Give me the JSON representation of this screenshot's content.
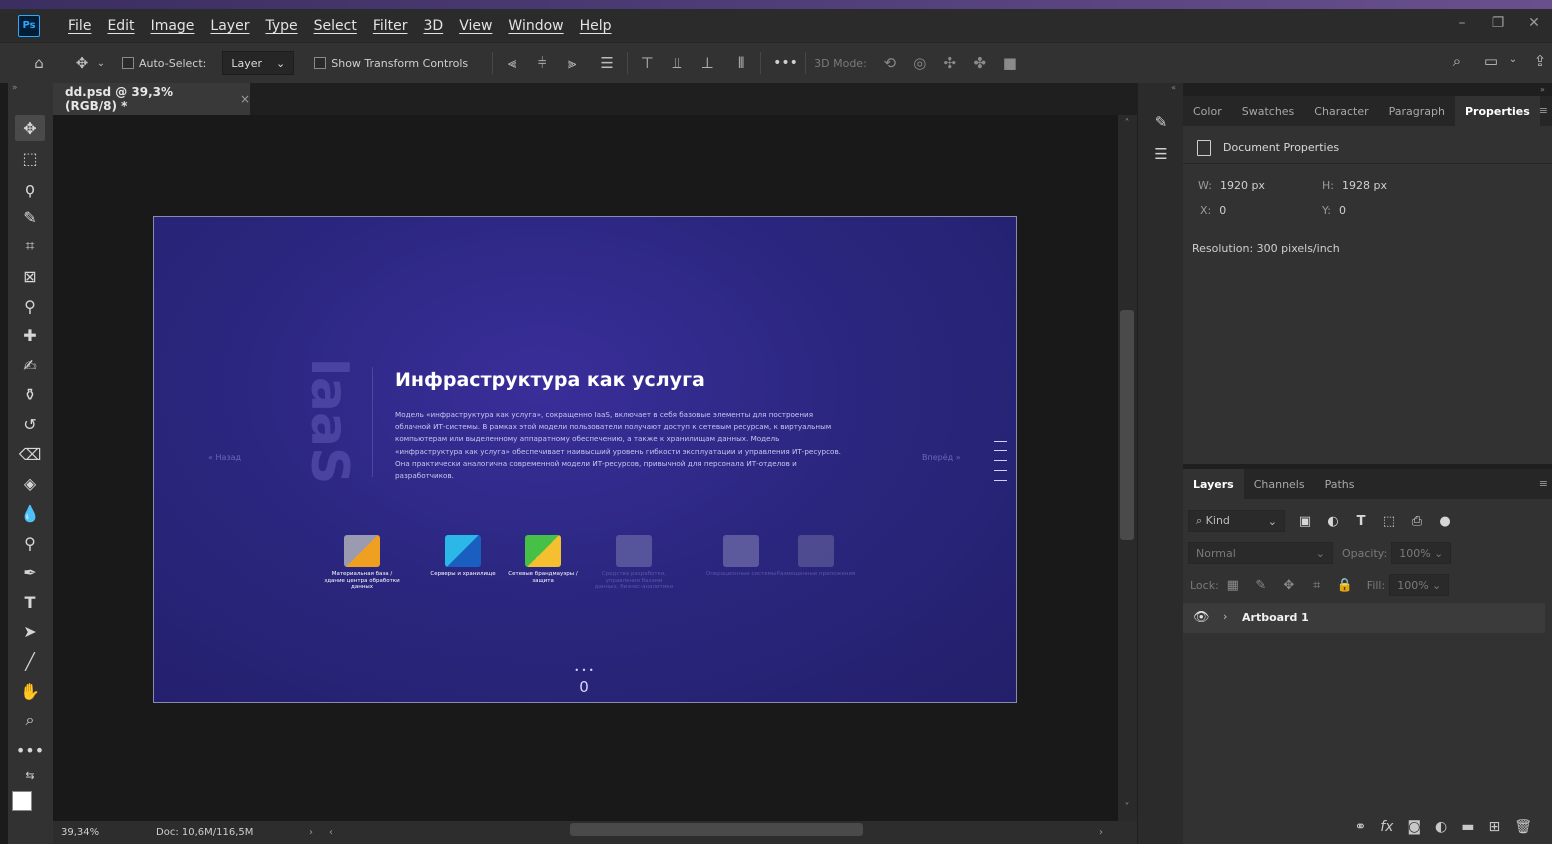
{
  "app": {
    "logo": "Ps"
  },
  "menu": [
    "File",
    "Edit",
    "Image",
    "Layer",
    "Type",
    "Select",
    "Filter",
    "3D",
    "View",
    "Window",
    "Help"
  ],
  "window_controls": [
    "minimize-icon",
    "restore-icon",
    "close-icon"
  ],
  "options_bar": {
    "auto_select_label": "Auto-Select:",
    "auto_select_value": "Layer",
    "show_transform_label": "Show Transform Controls",
    "more": "•••",
    "mode_3d_label": "3D Mode:"
  },
  "document": {
    "tab_title": "dd.psd @ 39,3% (RGB/8) *",
    "close": "×",
    "zoom": "39,34%",
    "doc_info": "Doc: 10,6M/116,5M"
  },
  "artboard": {
    "iaas": "IaaS",
    "title": "Инфраструктура как услуга",
    "body": "Модель «инфраструктура как услуга», сокращенно IaaS, включает в себя базовые элементы для построения облачной ИТ-системы. В рамках этой модели пользователи получают доступ к сетевым ресурсам, к виртуальным компьютерам или выделенному аппаратному обеспечению, а также к хранилищам данных. Модель «инфраструктура как услуга» обеспечивает наивысший уровень гибкости эксплуатации и управления ИТ-ресурсов. Она практически аналогична современной модели ИТ-ресурсов, привычной для персонала ИТ-отделов и разработчиков.",
    "prev": "« Назад",
    "next": "Вперёд »",
    "services": [
      {
        "label": "Материальная база / здание центра обработки данных",
        "dim": false
      },
      {
        "label": "Серверы и хранилище",
        "dim": false
      },
      {
        "label": "Сетевые брандмауэры / защита",
        "dim": false
      },
      {
        "label": "Средства разработки, управления базами данных, бизнес-аналитики",
        "dim": true
      },
      {
        "label": "Операционные системы",
        "dim": true
      },
      {
        "label": "Размещенные приложения",
        "dim": true
      }
    ],
    "pager_dots": "• • •",
    "pager_num": "0"
  },
  "panels": {
    "top_tabs": [
      "Color",
      "Swatches",
      "Character",
      "Paragraph",
      "Properties"
    ],
    "active_top_tab": "Properties",
    "properties": {
      "header": "Document Properties",
      "w_label": "W:",
      "w": "1920 px",
      "h_label": "H:",
      "h": "1928 px",
      "x_label": "X:",
      "x": "0",
      "y_label": "Y:",
      "y": "0",
      "resolution": "Resolution: 300 pixels/inch"
    },
    "layer_tabs": [
      "Layers",
      "Channels",
      "Paths"
    ],
    "active_layer_tab": "Layers",
    "layers": {
      "filter_kind": "Kind",
      "blend_mode": "Normal",
      "opacity_label": "Opacity:",
      "opacity": "100%",
      "lock_label": "Lock:",
      "fill_label": "Fill:",
      "fill": "100%",
      "items": [
        {
          "name": "Artboard 1"
        }
      ]
    }
  },
  "colors": {
    "accent": "#31a8ff",
    "artboard_bg": "#2b2780"
  }
}
